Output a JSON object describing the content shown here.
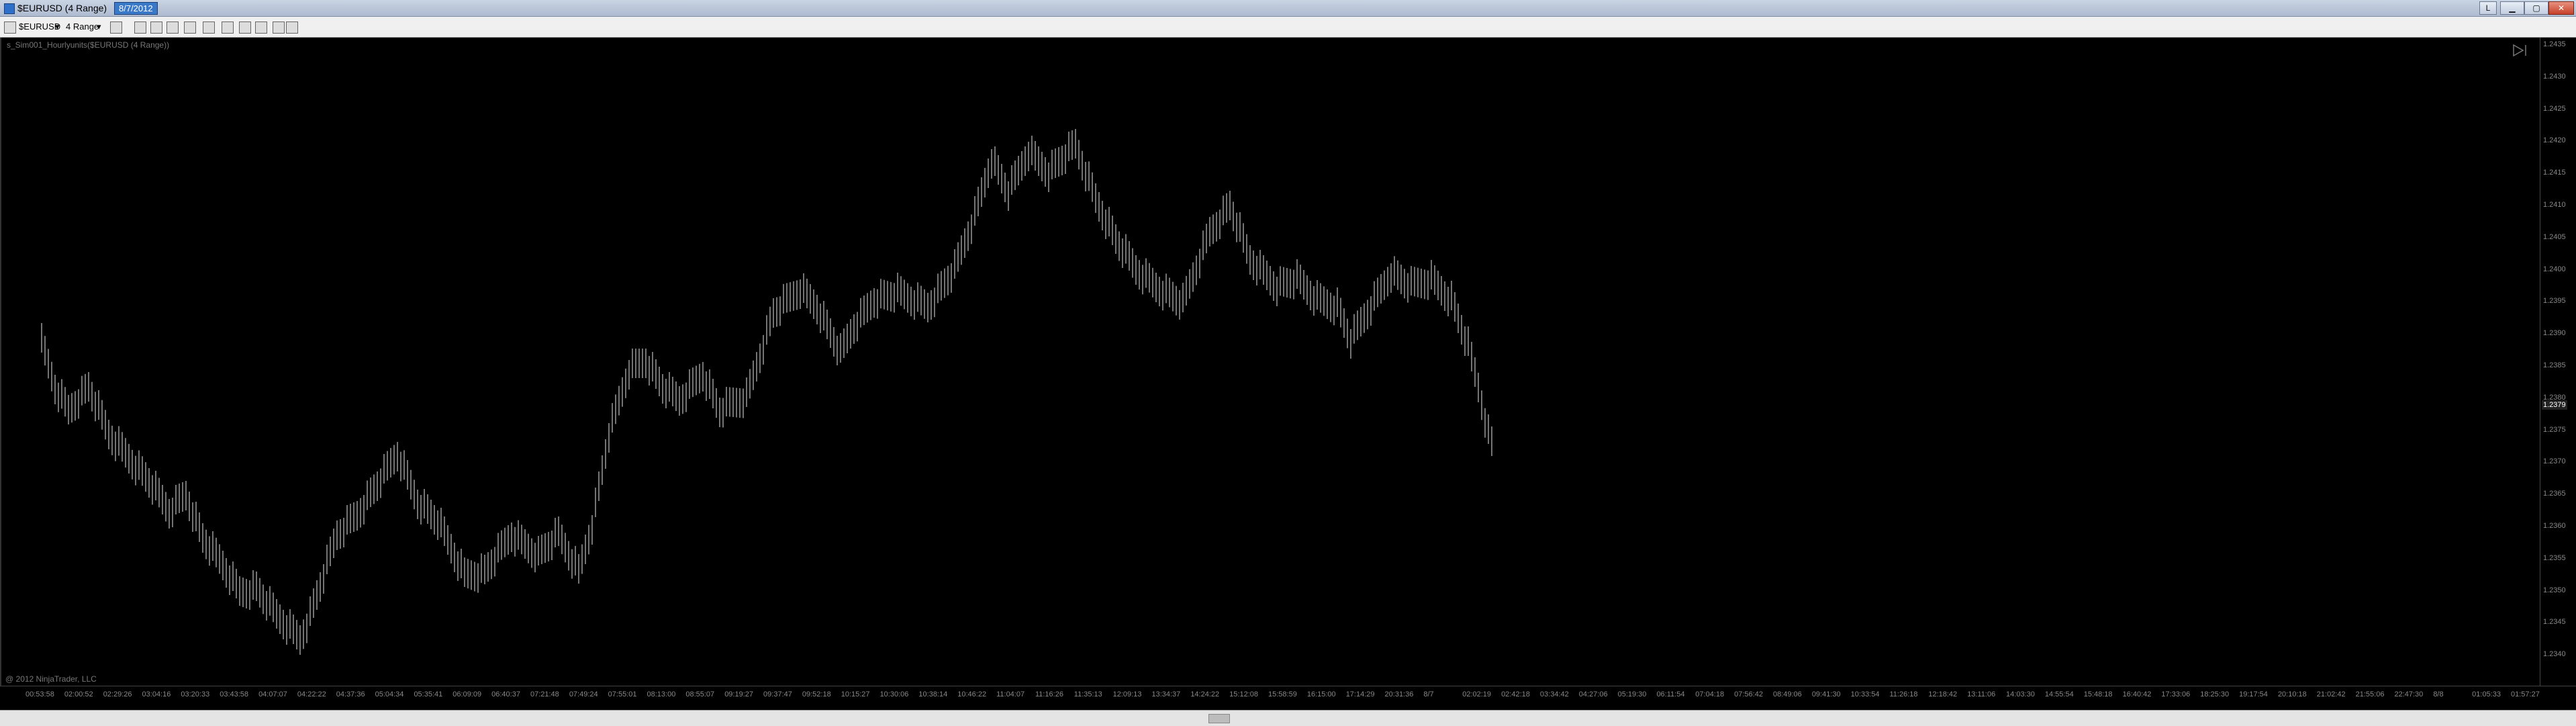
{
  "window": {
    "title": "$EURUSD (4 Range)",
    "date": "8/7/2012",
    "btn_l": "L"
  },
  "toolbar": {
    "instrument": "$EURUSD",
    "period": "4 Range"
  },
  "chart": {
    "label": "s_Sim001_Hourlyunits($EURUSD (4 Range))",
    "copyright": "@ 2012 NinjaTrader, LLC",
    "current_price": "1.2379",
    "price_ticks": [
      "1.2435",
      "1.2430",
      "1.2425",
      "1.2420",
      "1.2415",
      "1.2410",
      "1.2405",
      "1.2400",
      "1.2395",
      "1.2390",
      "1.2385",
      "1.2380",
      "1.2375",
      "1.2370",
      "1.2365",
      "1.2360",
      "1.2355",
      "1.2350",
      "1.2345",
      "1.2340"
    ],
    "time_ticks": [
      "00:53:58",
      "02:00:52",
      "02:29:26",
      "03:04:16",
      "03:20:33",
      "03:43:58",
      "04:07:07",
      "04:22:22",
      "04:37:36",
      "05:04:34",
      "05:35:41",
      "06:09:09",
      "06:40:37",
      "07:21:48",
      "07:49:24",
      "07:55:01",
      "08:13:00",
      "08:55:07",
      "09:19:27",
      "09:37:47",
      "09:52:18",
      "10:15:27",
      "10:30:06",
      "10:38:14",
      "10:46:22",
      "11:04:07",
      "11:16:26",
      "11:35:13",
      "12:09:13",
      "13:34:37",
      "14:24:22",
      "15:12:08",
      "15:58:59",
      "16:15:00",
      "17:14:29",
      "20:31:36",
      "8/7",
      "02:02:19",
      "02:42:18",
      "03:34:42",
      "04:27:06",
      "05:19:30",
      "06:11:54",
      "07:04:18",
      "07:56:42",
      "08:49:06",
      "09:41:30",
      "10:33:54",
      "11:26:18",
      "12:18:42",
      "13:11:06",
      "14:03:30",
      "14:55:54",
      "15:48:18",
      "16:40:42",
      "17:33:06",
      "18:25:30",
      "19:17:54",
      "20:10:18",
      "21:02:42",
      "21:55:06",
      "22:47:30",
      "8/8",
      "01:05:33",
      "01:57:27"
    ]
  }
}
